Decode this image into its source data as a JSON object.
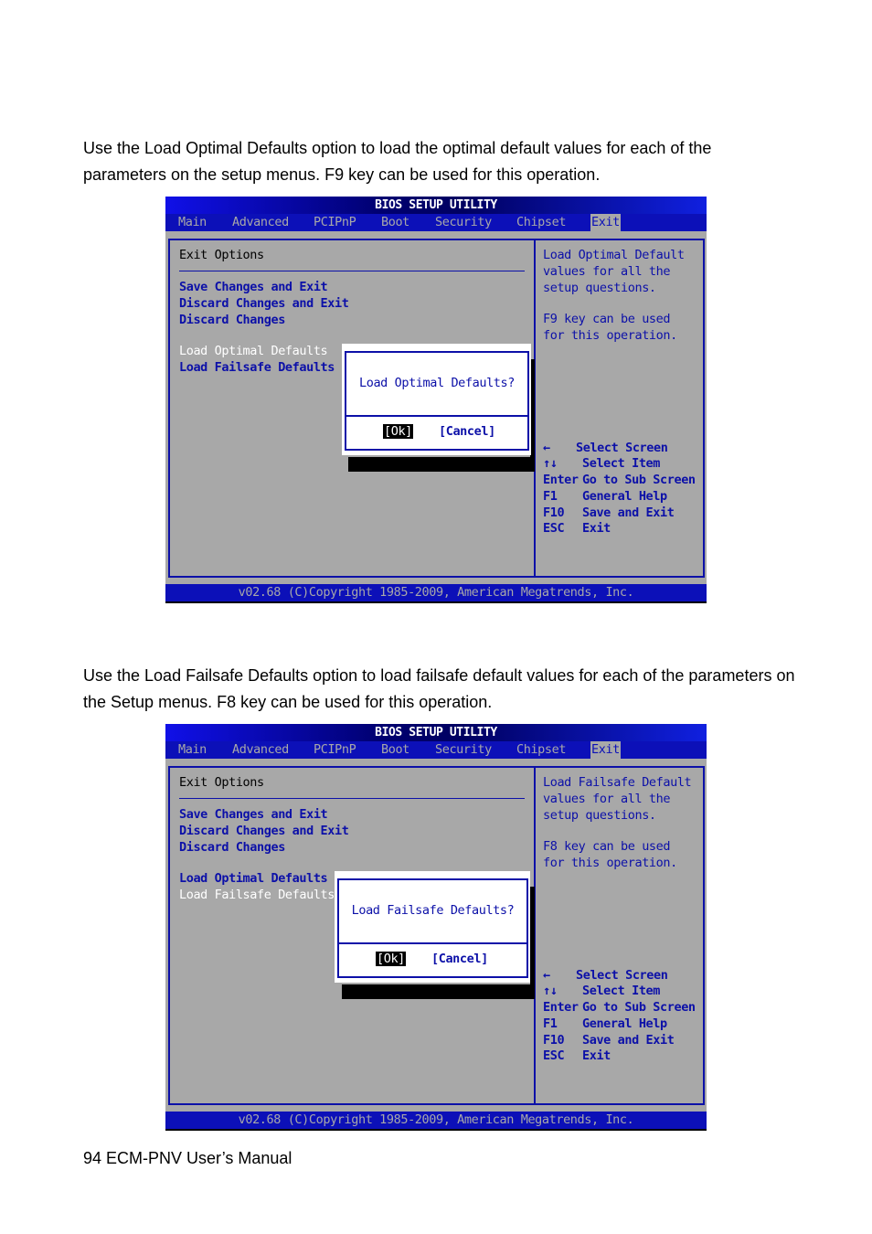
{
  "document": {
    "paragraph_optimal": "Use the Load Optimal Defaults option to load the optimal default values for each of the parameters on the setup menus. F9 key can be used for this operation.",
    "paragraph_failsafe": "Use the Load Failsafe Defaults option to load failsafe default values for each of the parameters on the Setup menus. F8 key can be used for this operation.",
    "footer": "94 ECM-PNV User’s Manual"
  },
  "bios_common": {
    "title": "BIOS SETUP UTILITY",
    "menu": [
      "Main",
      "Advanced",
      "PCIPnP",
      "Boot",
      "Security",
      "Chipset",
      "Exit"
    ],
    "active_menu": "Exit",
    "panel_title": "Exit Options",
    "options": [
      "Save Changes and Exit",
      "Discard Changes and Exit",
      "Discard Changes",
      "Load Optimal Defaults",
      "Load Failsafe Defaults"
    ],
    "keys": [
      {
        "key": "←",
        "action": "Select Screen"
      },
      {
        "key": "↑↓",
        "action": "Select Item"
      },
      {
        "key": "Enter",
        "action": "Go to Sub Screen"
      },
      {
        "key": "F1",
        "action": "General Help"
      },
      {
        "key": "F10",
        "action": "Save and Exit"
      },
      {
        "key": "ESC",
        "action": "Exit"
      }
    ],
    "status": "v02.68 (C)Copyright 1985-2009, American Megatrends, Inc.",
    "ok_label": "[Ok]",
    "cancel_label": "[Cancel]"
  },
  "screens": [
    {
      "selected_option": "Load Optimal Defaults",
      "help": [
        "Load Optimal Default",
        "values for all the",
        "setup questions.",
        "",
        "F9 key can be used",
        "for this operation."
      ],
      "dialog_question": "Load Optimal Defaults?"
    },
    {
      "selected_option": "Load Failsafe Defaults",
      "help": [
        "Load Failsafe Default",
        "values for all the",
        "setup questions.",
        "",
        "F8 key can be used",
        "for this operation."
      ],
      "dialog_question": "Load Failsafe Defaults?"
    }
  ],
  "colors": {
    "bios_blue": "#0c10b8",
    "panel_gray": "#a8a8a8",
    "text_blue": "#0c10a8",
    "highlight_white": "#ffffff"
  }
}
